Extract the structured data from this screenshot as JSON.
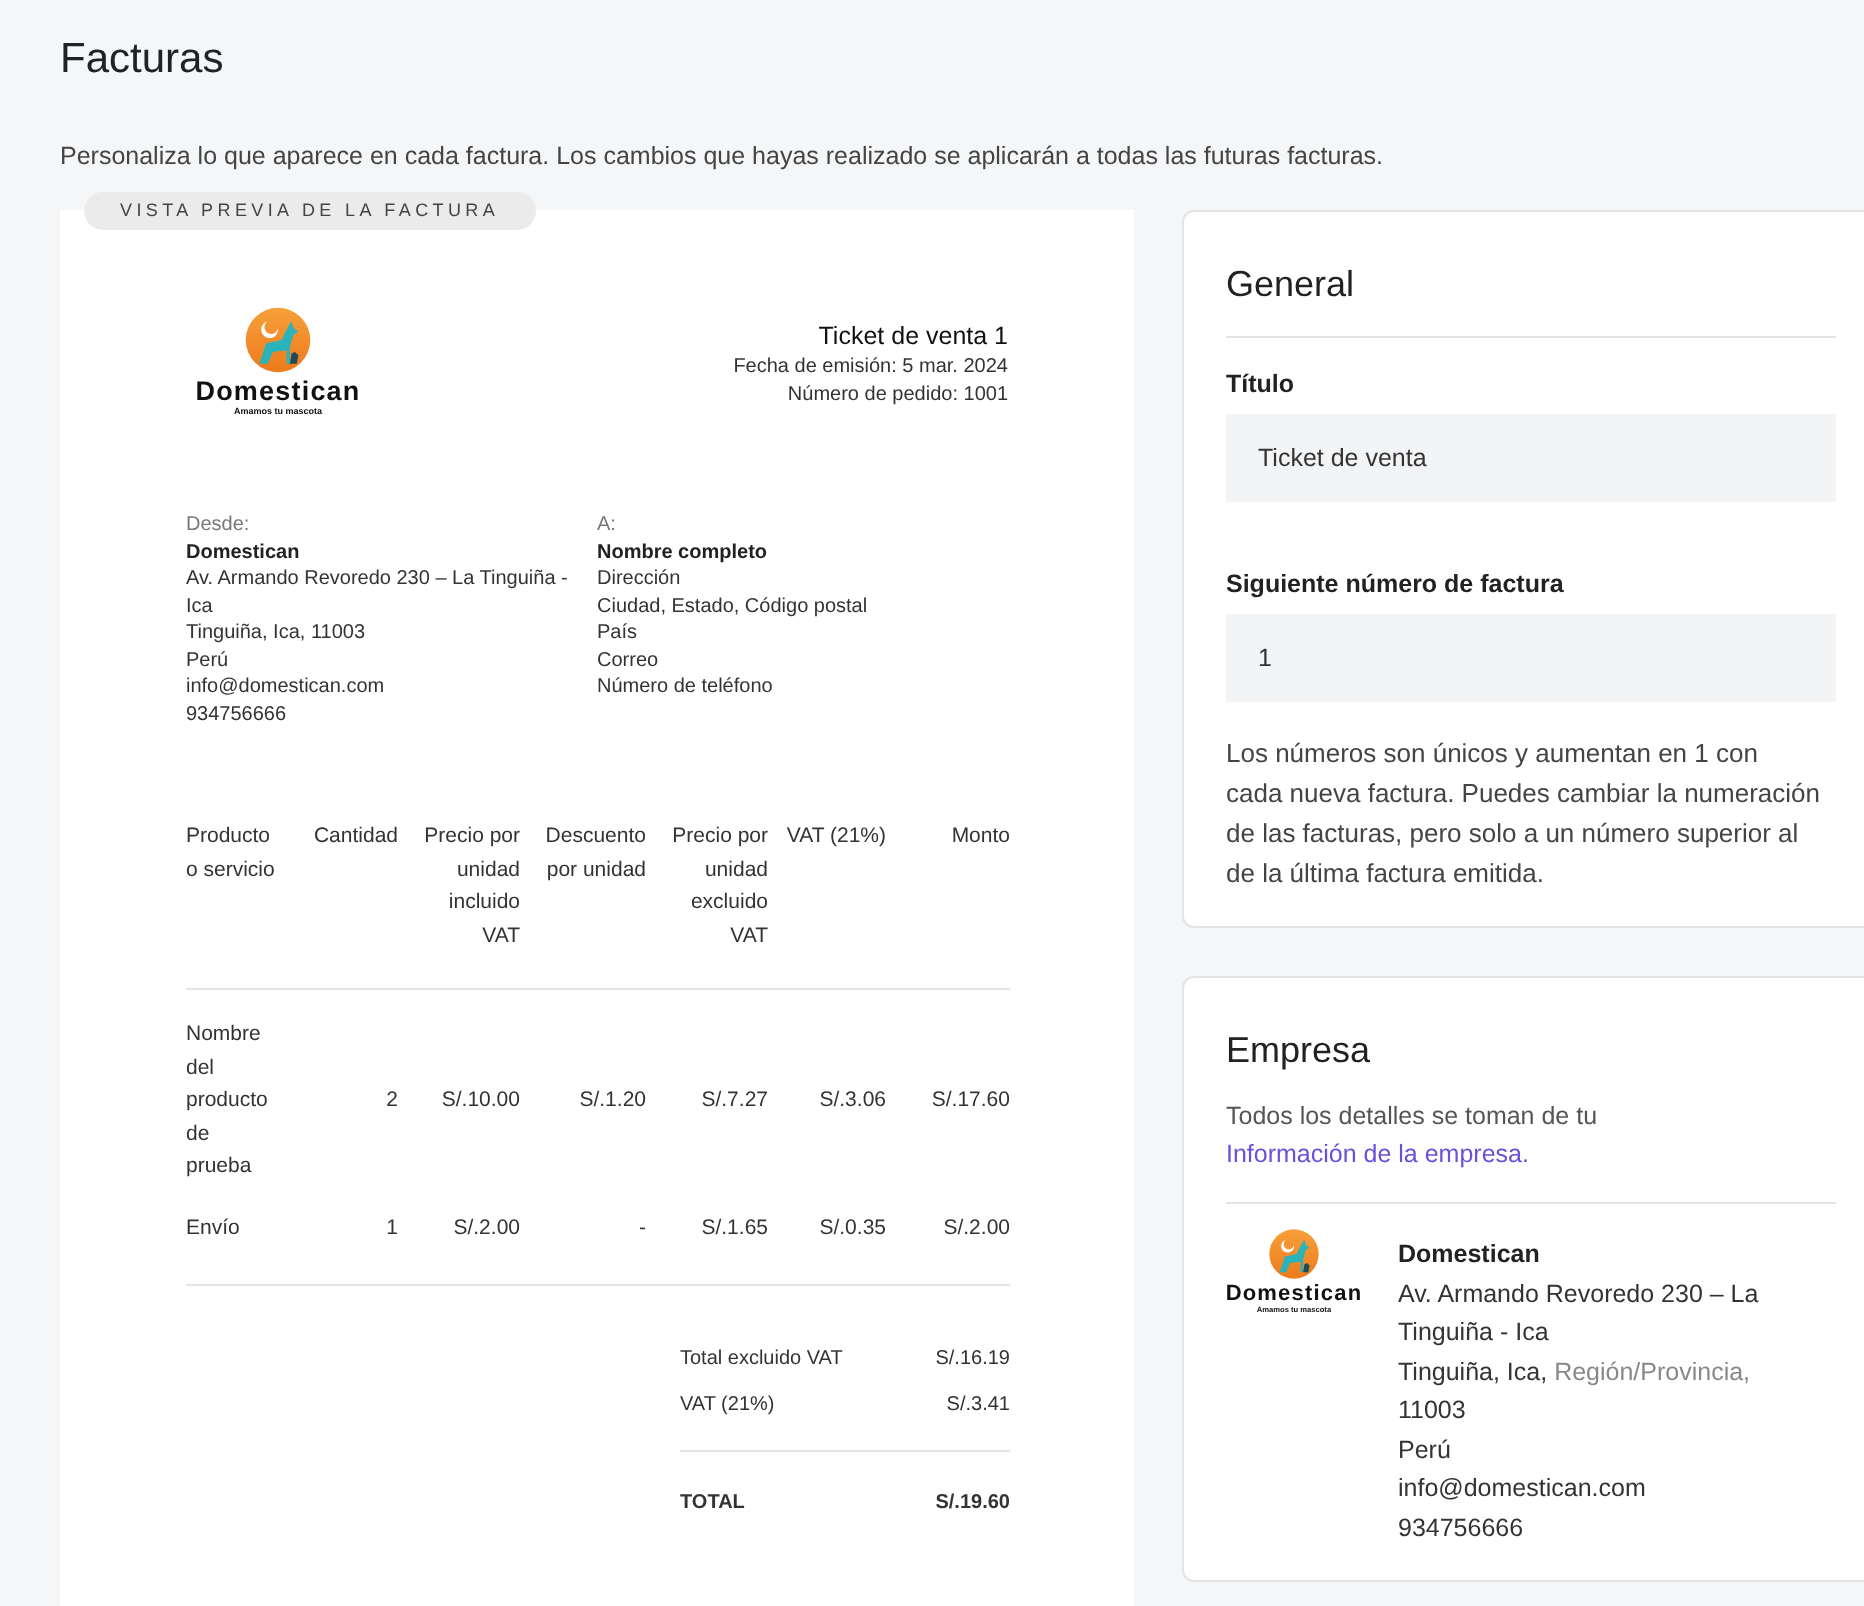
{
  "page": {
    "title": "Facturas",
    "subtitle": "Personaliza lo que aparece en cada factura. Los cambios que hayas realizado se aplicarán a todas las futuras facturas."
  },
  "preview": {
    "badge": "VISTA PREVIA DE LA FACTURA",
    "logo": {
      "name": "Domestican",
      "tagline": "Amamos tu mascota"
    },
    "ticket": {
      "title": "Ticket de venta 1",
      "lines": [
        "Fecha de emisión: 5 mar. 2024",
        "Número de pedido: 1001"
      ]
    },
    "parties": [
      {
        "label": "Desde:",
        "name": "Domestican",
        "lines": [
          "Av. Armando Revoredo 230 – La Tinguiña - Ica",
          "Tinguiña, Ica, 11003",
          "Perú",
          "info@domestican.com",
          "934756666"
        ]
      },
      {
        "label": "A:",
        "name": "Nombre completo",
        "lines": [
          "Dirección",
          "Ciudad, Estado, Código postal",
          "País",
          "Correo",
          "Número de teléfono"
        ]
      }
    ],
    "table": {
      "columns": [
        "Producto o servicio",
        "Cantidad",
        "Precio por unidad incluido VAT",
        "Descuento por unidad",
        "Precio por unidad excluido VAT",
        "VAT (21%)",
        "Monto"
      ],
      "rows": [
        [
          "Nombre del producto de prueba",
          "2",
          "S/.10.00",
          "S/.1.20",
          "S/.7.27",
          "S/.3.06",
          "S/.17.60"
        ],
        [
          "Envío",
          "1",
          "S/.2.00",
          "-",
          "S/.1.65",
          "S/.0.35",
          "S/.2.00"
        ]
      ]
    },
    "totals": [
      {
        "label": "Total excluido VAT",
        "value": "S/.16.19",
        "kind": "sub"
      },
      {
        "label": "VAT (21%)",
        "value": "S/.3.41",
        "kind": "sub"
      },
      {
        "label": "TOTAL",
        "value": "S/.19.60",
        "kind": "grand"
      }
    ]
  },
  "general": {
    "title": "General",
    "fields": [
      {
        "label": "Título",
        "value": "Ticket de venta"
      },
      {
        "label": "Siguiente número de factura",
        "value": "1"
      }
    ],
    "help": "Los números son únicos y aumentan en 1 con cada nueva factura. Puedes cambiar la numeración de las facturas, pero solo a un número superior al de la última factura emitida."
  },
  "company": {
    "title": "Empresa",
    "text": "Todos los detalles se toman de tu",
    "link": "Información de la empresa.",
    "logo": {
      "name": "Domestican",
      "tagline": "Amamos tu mascota"
    },
    "name": "Domestican",
    "lines": [
      [
        {
          "text": "Av. Armando Revoredo 230 – La Tinguiña - Ica",
          "muted": false
        }
      ],
      [
        {
          "text": "Tinguiña, Ica, ",
          "muted": false
        },
        {
          "text": "Región/Provincia,",
          "muted": true
        },
        {
          "text": " 11003",
          "muted": false
        }
      ],
      [
        {
          "text": "Perú",
          "muted": false
        }
      ],
      [
        {
          "text": "info@domestican.com",
          "muted": false
        }
      ],
      [
        {
          "text": "934756666",
          "muted": false
        }
      ]
    ]
  }
}
